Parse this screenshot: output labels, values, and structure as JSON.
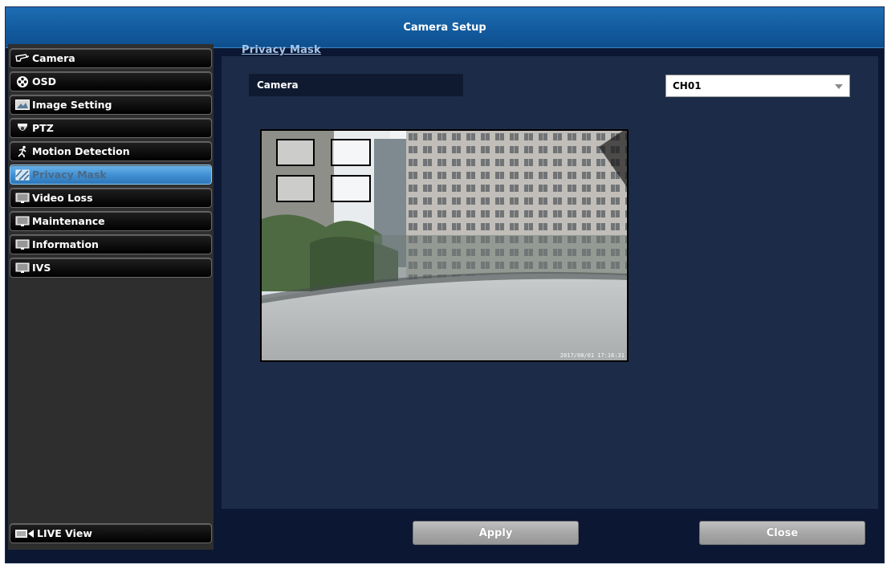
{
  "window": {
    "title": "Camera Setup"
  },
  "sidebar": {
    "items": [
      {
        "label": "Camera",
        "icon": "camera-icon",
        "active": false
      },
      {
        "label": "OSD",
        "icon": "osd-icon",
        "active": false
      },
      {
        "label": "Image Setting",
        "icon": "image-icon",
        "active": false
      },
      {
        "label": "PTZ",
        "icon": "ptz-dome-icon",
        "active": false
      },
      {
        "label": "Motion Detection",
        "icon": "running-man-icon",
        "active": false
      },
      {
        "label": "Privacy Mask",
        "icon": "privacy-mask-icon",
        "active": true
      },
      {
        "label": "Video Loss",
        "icon": "monitor-icon",
        "active": false
      },
      {
        "label": "Maintenance",
        "icon": "monitor-icon",
        "active": false
      },
      {
        "label": "Information",
        "icon": "monitor-icon",
        "active": false
      },
      {
        "label": "IVS",
        "icon": "monitor-icon",
        "active": false
      }
    ],
    "live_view": {
      "label": "LIVE View",
      "icon": "live-view-icon"
    }
  },
  "main": {
    "section_title": "Privacy Mask",
    "camera_label": "Camera",
    "camera_select": {
      "value": "CH01"
    },
    "preview": {
      "timestamp": "2017/08/01 17:16:31"
    }
  },
  "footer": {
    "apply_label": "Apply",
    "close_label": "Close"
  },
  "colors": {
    "title_bar": "#135b9e",
    "background": "#0b1733",
    "content_panel": "#1c2b47",
    "active_item": "#3f8fd2",
    "section_title": "#a5c7ec"
  }
}
